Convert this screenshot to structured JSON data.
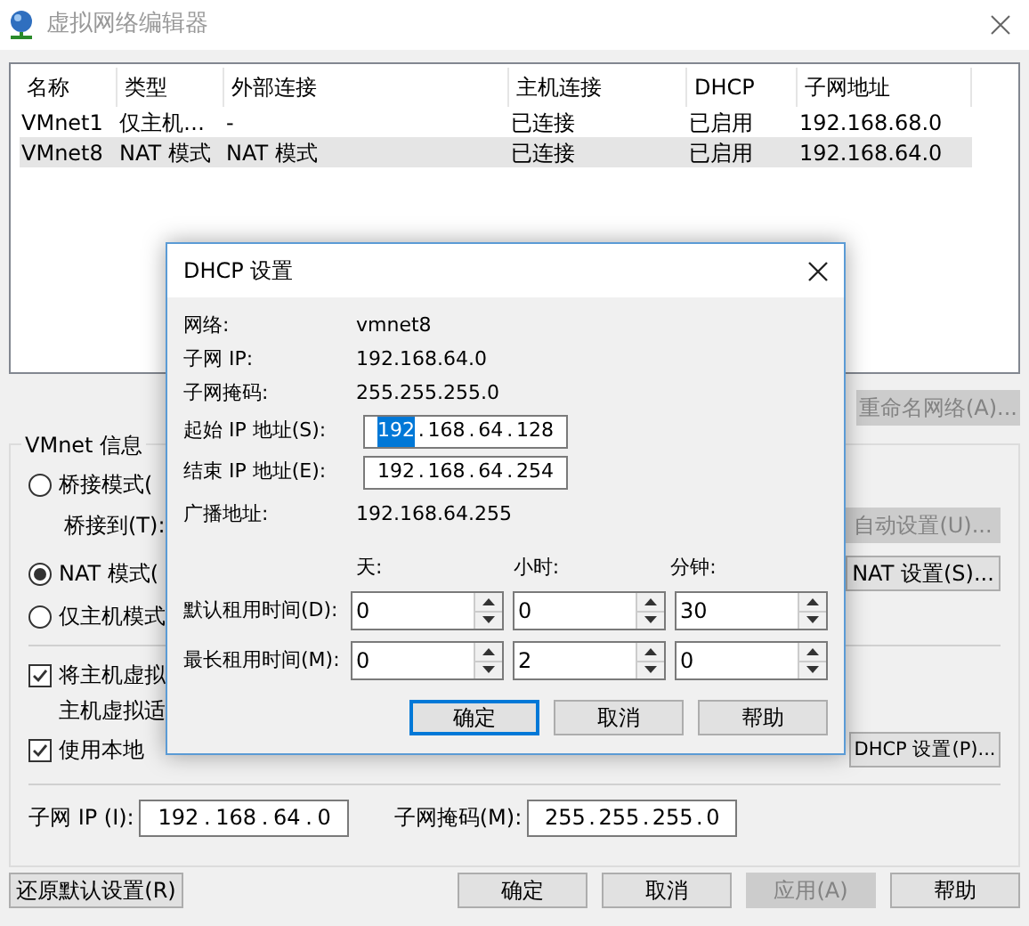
{
  "window": {
    "title": "虚拟网络编辑器"
  },
  "table": {
    "columns": [
      "名称",
      "类型",
      "外部连接",
      "主机连接",
      "DHCP",
      "子网地址"
    ],
    "rows": [
      {
        "cells": [
          "VMnet1",
          "仅主机…",
          "-",
          "已连接",
          "已启用",
          "192.168.68.0"
        ],
        "selected": false
      },
      {
        "cells": [
          "VMnet8",
          "NAT 模式",
          "NAT 模式",
          "已连接",
          "已启用",
          "192.168.64.0"
        ],
        "selected": true
      }
    ]
  },
  "rename_button": {
    "label": "重命名网络(A)...",
    "disabled": true
  },
  "vmnet_info": {
    "title": "VMnet 信息",
    "modes": [
      {
        "label": "桥接模式(",
        "selected": false
      },
      {
        "label": "NAT 模式(",
        "selected": true
      },
      {
        "label": "仅主机模式",
        "selected": false
      }
    ],
    "bridge_to_label": "桥接到(T):",
    "auto_button": {
      "label": "自动设置(U)...",
      "disabled": true
    },
    "nat_button": {
      "label": "NAT 设置(S)...",
      "disabled": false
    },
    "checks": [
      {
        "label": "将主机虚拟",
        "checked": true,
        "note": "主机虚拟适"
      },
      {
        "label": "使用本地",
        "checked": true
      }
    ],
    "dhcp_button": {
      "label": "DHCP 设置(P)...",
      "disabled": false
    },
    "subnet_ip": {
      "label": "子网 IP (I):",
      "separator": ".",
      "octets": [
        "192",
        "168",
        "64",
        "0"
      ]
    },
    "subnet_mask": {
      "label": "子网掩码(M):",
      "separator": ".",
      "octets": [
        "255",
        "255",
        "255",
        "0"
      ]
    }
  },
  "buttons": [
    {
      "label": "还原默认设置(R)",
      "disabled": false
    },
    {
      "label": "确定",
      "disabled": false
    },
    {
      "label": "取消",
      "disabled": false
    },
    {
      "label": "应用(A)",
      "disabled": true
    },
    {
      "label": "帮助",
      "disabled": false
    }
  ],
  "dialog": {
    "title": "DHCP 设置",
    "items": [
      {
        "kind": "text",
        "label": "网络:",
        "value": "vmnet8"
      },
      {
        "kind": "text",
        "label": "子网 IP:",
        "value": "192.168.64.0"
      },
      {
        "kind": "text",
        "label": "子网掩码:",
        "value": "255.255.255.0"
      },
      {
        "kind": "ip",
        "label": "起始 IP 地址(S):",
        "separator": ".",
        "octets": [
          {
            "text": "192",
            "selected": true
          },
          {
            "text": "168",
            "selected": false
          },
          {
            "text": "64",
            "selected": false
          },
          {
            "text": "128",
            "selected": false
          }
        ]
      },
      {
        "kind": "ip",
        "label": "结束 IP 地址(E):",
        "separator": ".",
        "octets": [
          {
            "text": "192",
            "selected": false
          },
          {
            "text": "168",
            "selected": false
          },
          {
            "text": "64",
            "selected": false
          },
          {
            "text": "254",
            "selected": false
          }
        ]
      },
      {
        "kind": "text",
        "label": "广播地址:",
        "value": "192.168.64.255"
      }
    ],
    "lease_columns": [
      "天:",
      "小时:",
      "分钟:"
    ],
    "lease_rows": [
      {
        "label": "默认租用时间(D):",
        "values": [
          "0",
          "0",
          "30"
        ]
      },
      {
        "label": "最长租用时间(M):",
        "values": [
          "0",
          "2",
          "0"
        ]
      }
    ],
    "buttons": [
      {
        "label": "确定",
        "default": true
      },
      {
        "label": "取消",
        "default": false
      },
      {
        "label": "帮助",
        "default": false
      }
    ]
  }
}
